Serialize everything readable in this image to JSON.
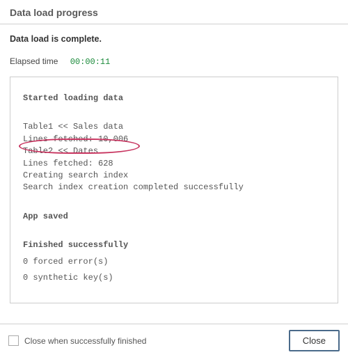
{
  "header": {
    "title": "Data load progress"
  },
  "status": "Data load is complete.",
  "elapsed": {
    "label": "Elapsed time",
    "value": "00:00:11"
  },
  "log": {
    "started": "Started loading data",
    "line_table1": "Table1 << Sales data",
    "line_fetched1": "Lines fetched: 10,006",
    "line_table2": "Table2 << Dates",
    "line_fetched2": "Lines fetched: 628",
    "line_index1": "Creating search index",
    "line_index2": "Search index creation completed successfully",
    "app_saved": "App saved",
    "finished": "Finished successfully",
    "forced_errors": "0 forced error(s)",
    "synthetic_keys": "0 synthetic key(s)"
  },
  "footer": {
    "checkbox_label": "Close when successfully finished",
    "close_label": "Close"
  }
}
